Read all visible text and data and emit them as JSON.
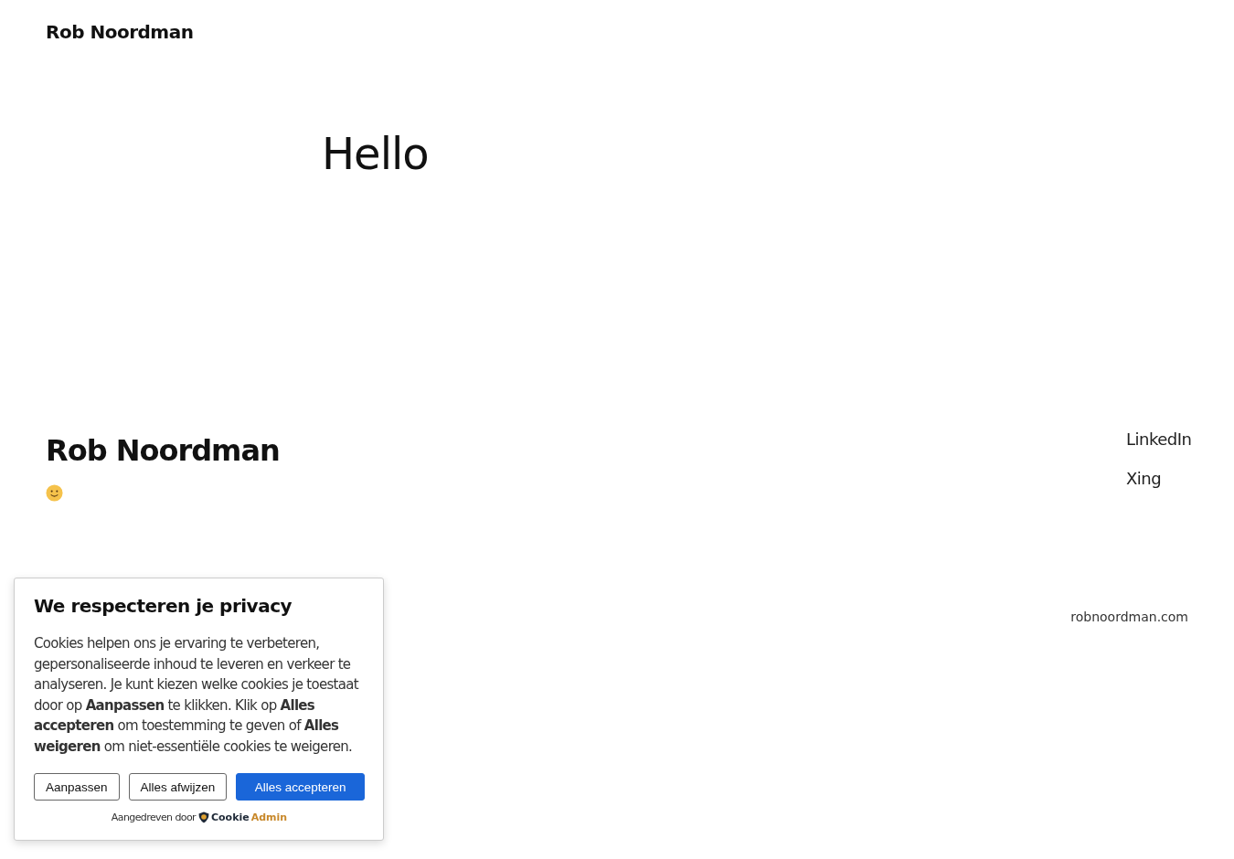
{
  "site_title": "Rob Noordman",
  "heading": "Hello",
  "footer": {
    "name": "Rob Noordman",
    "links": [
      "LinkedIn",
      "Xing"
    ],
    "domain": "robnoordman.com"
  },
  "cookie_banner": {
    "title": "We respecteren je privacy",
    "text": "Cookies helpen ons je ervaring te verbeteren, gepersonaliseerde inhoud te leveren en verkeer te analyseren. Je kunt kiezen welke cookies je toestaat door op **Aanpassen** te klikken. Klik op **Alles accepteren** om toestemming te geven of **Alles weigeren** om niet-essentiële cookies te weigeren.",
    "buttons": [
      {
        "label": "Aanpassen",
        "kind": "outline"
      },
      {
        "label": "Alles afwijzen",
        "kind": "outline"
      },
      {
        "label": "Alles accepteren",
        "kind": "primary"
      }
    ],
    "powered_by": "Aangedreven door",
    "brand": {
      "part_1": "Cookie",
      "part_2": "Admin"
    }
  }
}
